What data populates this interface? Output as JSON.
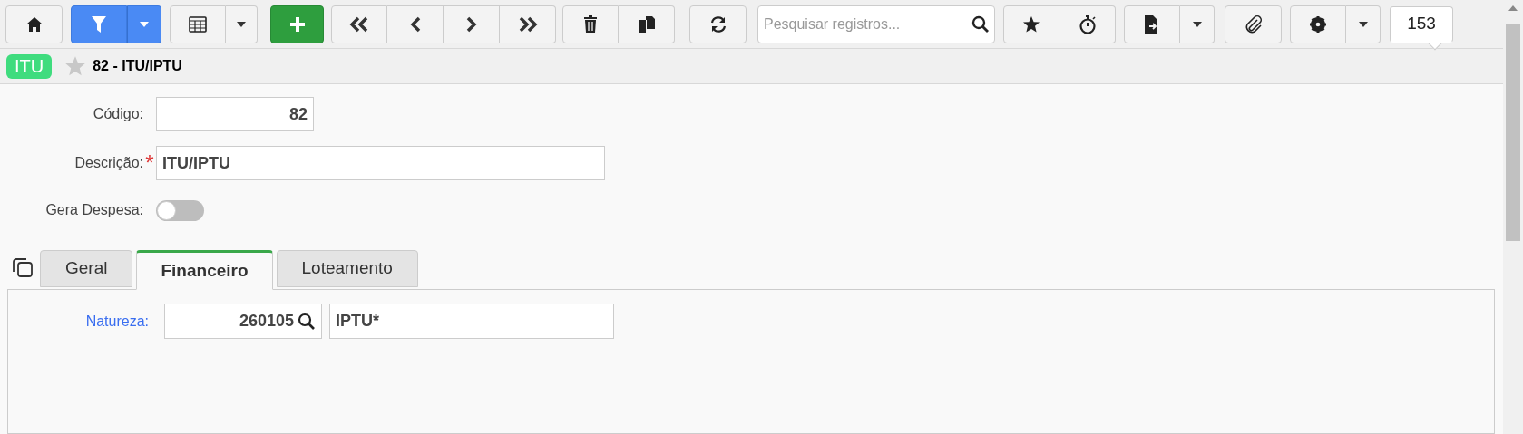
{
  "toolbar": {
    "search": {
      "placeholder": "Pesquisar registros..."
    },
    "record_count": "153"
  },
  "header": {
    "badge": "ITU",
    "favorite": false,
    "title": "82 - ITU/IPTU"
  },
  "form": {
    "codigo": {
      "label": "Código:",
      "value": "82"
    },
    "descricao": {
      "label": "Descrição:",
      "required_mark": "*",
      "value": "ITU/IPTU"
    },
    "gera_despesa": {
      "label": "Gera Despesa:",
      "on": false
    }
  },
  "tabs": [
    {
      "label": "Geral",
      "selected": false
    },
    {
      "label": "Financeiro",
      "selected": true
    },
    {
      "label": "Loteamento",
      "selected": false
    }
  ],
  "financeiro": {
    "natureza": {
      "label": "Natureza:",
      "code": "260105",
      "description": "IPTU*"
    }
  }
}
